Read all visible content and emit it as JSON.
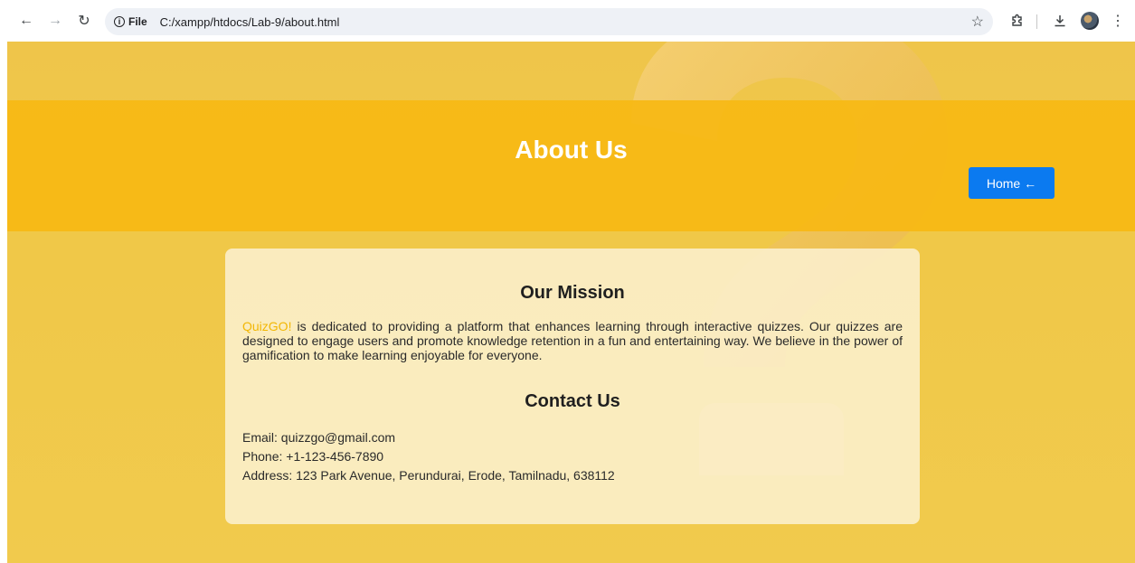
{
  "browser": {
    "protocol_label": "File",
    "url": "C:/xampp/htdocs/Lab-9/about.html"
  },
  "header": {
    "title": "About Us",
    "home_button": "Home ←"
  },
  "mission": {
    "title": "Our Mission",
    "brand": "QuizGO!",
    "text": " is dedicated to providing a platform that enhances learning through interactive quizzes. Our quizzes are designed to engage users and promote knowledge retention in a fun and entertaining way. We believe in the power of gamification to make learning enjoyable for everyone."
  },
  "contact": {
    "title": "Contact Us",
    "email": "Email: quizzgo@gmail.com",
    "phone": "Phone: +1-123-456-7890",
    "address": "Address: 123 Park Avenue, Perundurai, Erode, Tamilnadu, 638112"
  },
  "colors": {
    "header_band": "#f7b814",
    "page_bg": "#f0c848",
    "home_button": "#0b7af0",
    "brand": "#f2b705"
  }
}
